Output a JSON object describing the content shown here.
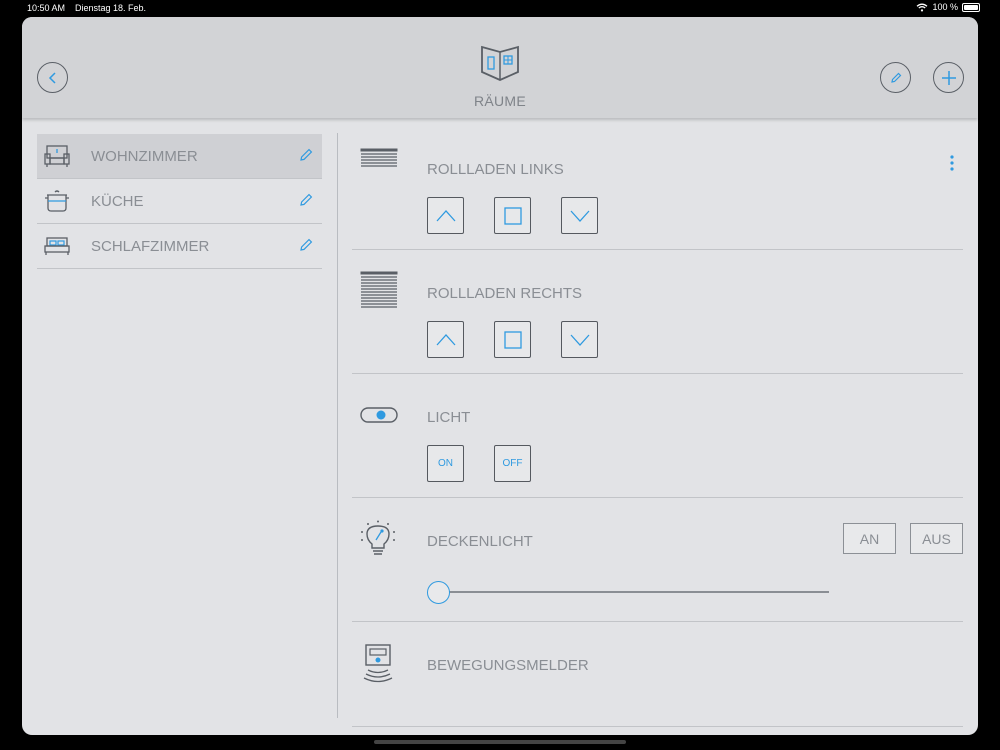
{
  "status_bar": {
    "time": "10:50 AM",
    "date": "Dienstag 18. Feb.",
    "battery": "100 %"
  },
  "header": {
    "title": "RÄUME"
  },
  "rooms": [
    {
      "label": "WOHNZIMMER",
      "icon": "sofa-icon",
      "selected": true
    },
    {
      "label": "KÜCHE",
      "icon": "pot-icon",
      "selected": false
    },
    {
      "label": "SCHLAFZIMMER",
      "icon": "bed-icon",
      "selected": false
    }
  ],
  "devices": {
    "rollladen_links": {
      "label": "ROLLLADEN LINKS"
    },
    "rollladen_rechts": {
      "label": "ROLLLADEN RECHTS"
    },
    "licht": {
      "label": "LICHT",
      "on_label": "ON",
      "off_label": "OFF"
    },
    "deckenlicht": {
      "label": "DECKENLICHT",
      "an_label": "AN",
      "aus_label": "AUS",
      "dim_level": 0
    },
    "bewegungsmelder": {
      "label": "BEWEGUNGSMELDER"
    }
  },
  "colors": {
    "accent": "#2f9ae0",
    "background": "#e2e3e6",
    "header": "#d2d3d6",
    "text": "#8a8e94"
  }
}
